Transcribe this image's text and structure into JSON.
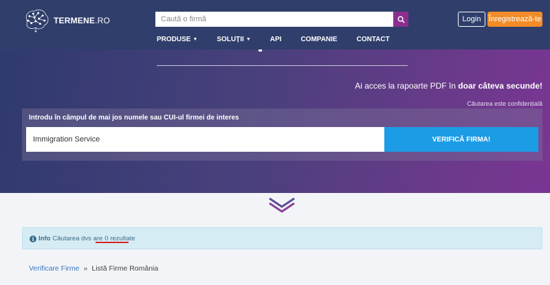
{
  "brand": {
    "name_bold": "TERMENE",
    "name_suffix": ".RO"
  },
  "header": {
    "search_placeholder": "Caută o firmă",
    "login_label": "Login",
    "register_label": "Înregistrează-te"
  },
  "menu": {
    "items": [
      {
        "label": "PRODUSE",
        "has_dropdown": true
      },
      {
        "label": "SOLUȚII",
        "has_dropdown": true
      },
      {
        "label": "API",
        "has_dropdown": false
      },
      {
        "label": "COMPANIE",
        "has_dropdown": false
      },
      {
        "label": "CONTACT",
        "has_dropdown": false
      }
    ]
  },
  "hero": {
    "promo_prefix": "Ai acces la rapoarte PDF în ",
    "promo_bold": "doar câteva secunde!",
    "confidential": "Căutarea este confidențială",
    "search_label": "Introdu în câmpul de mai jos numele sau CUI-ul firmei de interes",
    "search_value": "Immigration Service",
    "verify_label": "VERIFICĂ FIRMA!"
  },
  "info": {
    "label": "Info",
    "text": "Căutarea dvs are",
    "count": "0 rezultate"
  },
  "breadcrumb": {
    "link": "Verificare Firme",
    "separator": "»",
    "current": "Listă Firme România"
  },
  "colors": {
    "nav_bg": "#2f3e6b",
    "accent_purple": "#8b2f8e",
    "register_orange": "#f28c28",
    "verify_blue": "#1d9ce6",
    "info_bg": "#d6ecf5",
    "underline_red": "#d32323"
  }
}
